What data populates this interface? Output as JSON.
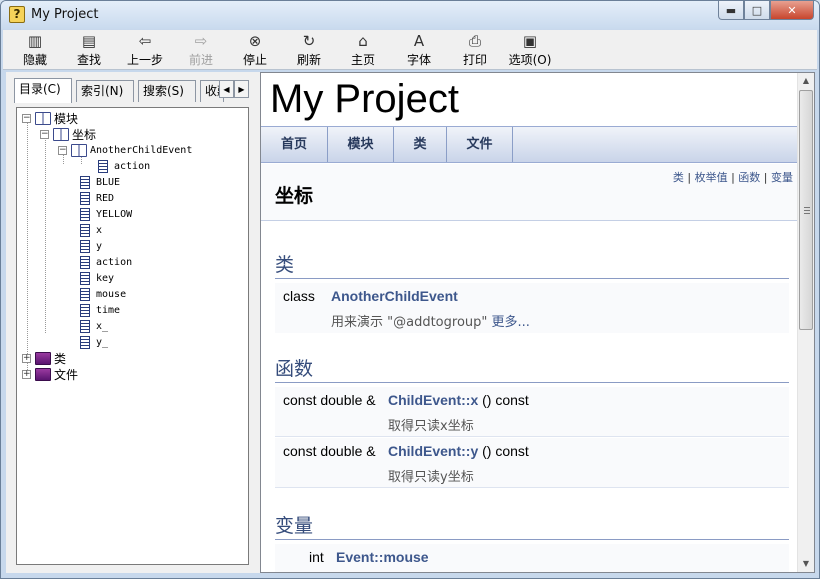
{
  "window": {
    "title": "My Project",
    "min_label": "▬",
    "max_label": "□",
    "close_label": "✕"
  },
  "toolbar": {
    "hide": "隐藏",
    "find": "查找",
    "back": "上一步",
    "forward": "前进",
    "stop": "停止",
    "refresh": "刷新",
    "home": "主页",
    "font": "字体",
    "print": "打印",
    "options": "选项(O)"
  },
  "tabs": {
    "contents": "目录(C)",
    "index": "索引(N)",
    "search": "搜索(S)",
    "favorites": "收藏"
  },
  "tree": {
    "modules": "模块",
    "coords": "坐标",
    "another_child_event": "AnotherChildEvent",
    "items": [
      "action",
      "BLUE",
      "RED",
      "YELLOW",
      "x",
      "y",
      "action",
      "key",
      "mouse",
      "time",
      "x_",
      "y_"
    ],
    "classes": "类",
    "files": "文件"
  },
  "page": {
    "project_title": "My Project",
    "nav": [
      "首页",
      "模块",
      "类",
      "文件"
    ],
    "summary_links": [
      "类",
      "枚举值",
      "函数",
      "变量"
    ],
    "heading": "坐标",
    "sections": {
      "classes": "类",
      "functions": "函数",
      "variables": "变量"
    },
    "class_member": {
      "type": "class",
      "name": "AnotherChildEvent",
      "desc": "用来演示 \"@addtogroup\"",
      "more": "更多..."
    },
    "functions": [
      {
        "type": "const double &",
        "name": "ChildEvent::x",
        "suffix": " () const",
        "desc": "取得只读x坐标"
      },
      {
        "type": "const double &",
        "name": "ChildEvent::y",
        "suffix": " () const",
        "desc": "取得只读y坐标"
      }
    ],
    "variable": {
      "type": "int",
      "name": "Event::mouse"
    }
  },
  "colors": {
    "link": "#3d578c",
    "section": "#354c7b",
    "nav_text": "#283a5d"
  }
}
